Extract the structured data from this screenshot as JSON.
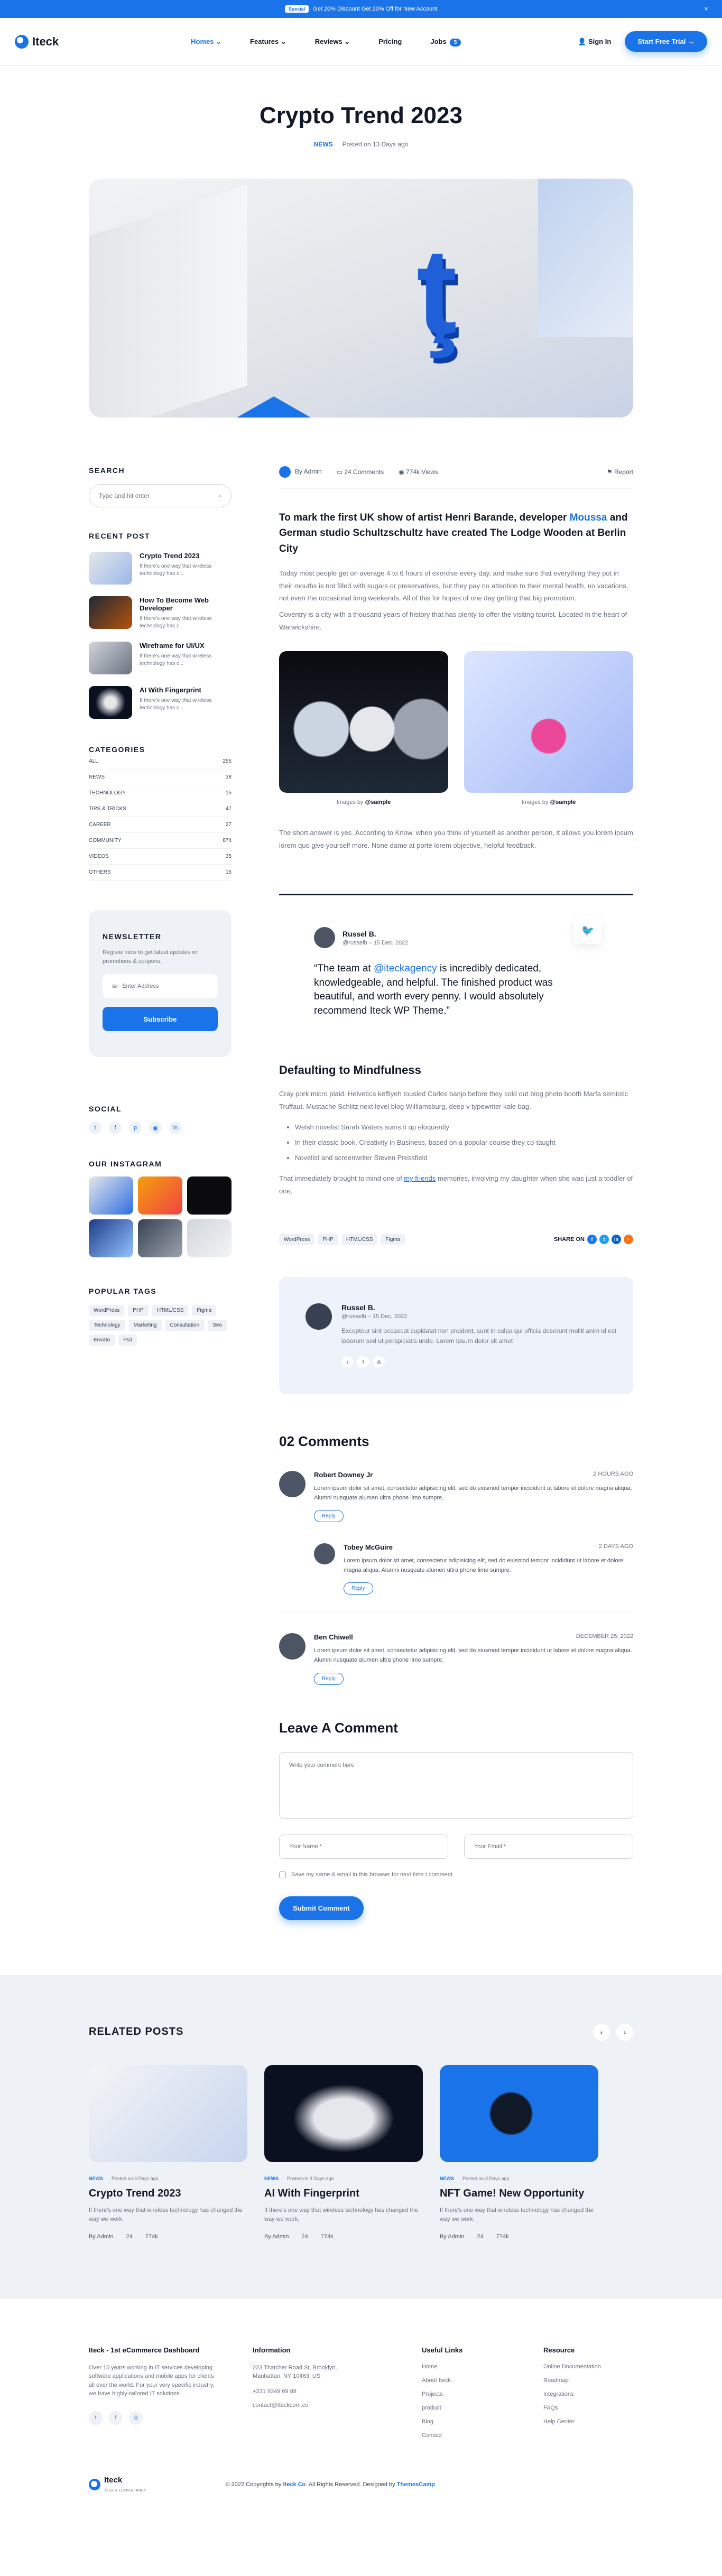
{
  "promo": {
    "pill": "Special",
    "text": "Get 20% Discount Get 20% Off for New Account",
    "close": "×"
  },
  "header": {
    "logo": "Iteck",
    "nav": [
      {
        "label": "Homes ⌄"
      },
      {
        "label": "Features ⌄"
      },
      {
        "label": "Reviews ⌄"
      },
      {
        "label": "Pricing"
      },
      {
        "label": "Jobs"
      }
    ],
    "jobs_badge": "5",
    "sign_in": "Sign In",
    "cta": "Start Free Trial →"
  },
  "post": {
    "title": "Crypto Trend 2023",
    "category": "NEWS",
    "posted": "Posted on 13 Days ago",
    "by": "By Admin",
    "comments": "24 Comments",
    "views": "774k Views",
    "report": "Report",
    "lead_a": "To mark the first UK show of artist Henri Barande, developer ",
    "lead_hl": "Moussa",
    "lead_b": " and German studio Schultzschultz have created The Lodge Wooden at Berlin City",
    "p1": "Today most people get on average 4 to 6 hours of exercise every day, and make sure that everything they put in their mouths is not filled with sugars or preservatives, but they pay no attention to their mental health, no vacations, not even the occasional long weekends. All of this for hopes of one day getting that big promotion.",
    "p2": "Coventry is a city with a thousand years of history that has plenty to offer the visiting tourist. Located in the heart of Warwickshire.",
    "cap_pre": "Images by ",
    "cap1": "@sample",
    "cap2": "@sample",
    "p3": "The short answer is yes. According to Know, when you think of yourself as another person, it allows you lorem ipsum lorem quo give yourself more. None dame at porte lorem objective, helpful feedback.",
    "quote_name": "Russel B.",
    "quote_sub": "@russelb – 15 Dec, 2022",
    "quote_a": "“The team at ",
    "quote_hl": "@iteckagency",
    "quote_b": " is incredibly dedicated, knowledgeable, and helpful. The finished product was beautiful, and worth every penny. I would absolutely recommend Iteck WP Theme.”",
    "h2": "Defaulting to Mindfulness",
    "p4": "Cray pork micro plaid. Helvetica keffiyeh tousled Carles banjo before they sold out blog photo booth Marfa semiotic Truffaut. Mustache Schlitz next level blog Williamsburg, deep v typewriter kale bag.",
    "bullets": [
      "Welsh novelist Sarah Waters sums it up eloquently",
      "In their classic book, Creativity in Business, based on a popular course they co-taught",
      "Novelist and screenwriter Steven Pressfield"
    ],
    "p5a": "That immediately brought to mind one of ",
    "p5link": "my friends",
    "p5b": " memories, involving my daughter when she was just a toddler of one.",
    "tags": [
      "WordPress",
      "PHP",
      "HTML/CSS",
      "Figma"
    ],
    "share": "SHARE ON",
    "author_name": "Russel B.",
    "author_sub": "@russelb – 15 Dec, 2022",
    "author_text": "Excepteur sint occaecat cupidatat non proident, sunt in culpa qui officia deserunt mollit anim id est laborum sed ut perspiciatis unde. Lorem ipsum dolor sit amet"
  },
  "comments": {
    "heading": "02 Comments",
    "items": [
      {
        "name": "Robert Downey Jr",
        "time": "2 HOURS AGO",
        "text": "Lorem ipsum dolor sit amet, consectetur adipisicing elit, sed do eiusmod tempor incididunt ut labore et dolore magna aliqua. Alumni nusquate alumen ultra phone limo sumpre.",
        "reply": "Reply"
      },
      {
        "name": "Tobey McGuire",
        "time": "2 DAYS AGO",
        "text": "Lorem ipsum dolor sit amet, consectetur adipisicing elit, sed do eiusmod tempor incididunt ut labore et dolore magna aliqua. Alumni nusquate alumen ultra phone limo sumpre.",
        "reply": "Reply"
      },
      {
        "name": "Ben Chiwell",
        "time": "DECEMBER 25, 2022",
        "text": "Lorem ipsum dolor sit amet, consectetur adipisicing elit, sed do eiusmod tempor incididunt ut labore et dolore magna aliqua. Alumni nusquate alumen ultra phone limo sumpre.",
        "reply": "Reply"
      }
    ]
  },
  "form": {
    "heading": "Leave A Comment",
    "comment_ph": "Write your comment here",
    "name_ph": "Your Name *",
    "email_ph": "Your Email *",
    "save": "Save my name & email in this browser for next time I comment",
    "submit": "Submit Comment"
  },
  "sidebar": {
    "search_title": "SEARCH",
    "search_ph": "Type and hit enter",
    "recent_title": "RECENT POST",
    "recent": [
      {
        "title": "Crypto Trend 2023",
        "desc": "If there's one way that wireless technology has c..."
      },
      {
        "title": "How To Become Web Developer",
        "desc": "If there's one way that wireless technology has c..."
      },
      {
        "title": "Wireframe for UI/UX",
        "desc": "If there's one way that wireless technology has c..."
      },
      {
        "title": "AI With Fingerprint",
        "desc": "If there's one way that wireless technology has c..."
      }
    ],
    "cat_title": "CATEGORIES",
    "cats": [
      {
        "name": "ALL",
        "count": "255"
      },
      {
        "name": "NEWS",
        "count": "38"
      },
      {
        "name": "TECHNOLOGY",
        "count": "15"
      },
      {
        "name": "TIPS & TRICKS",
        "count": "47"
      },
      {
        "name": "CAREER",
        "count": "27"
      },
      {
        "name": "COMMUNITY",
        "count": "874"
      },
      {
        "name": "VIDEOS",
        "count": "35"
      },
      {
        "name": "OTHERS",
        "count": "15"
      }
    ],
    "nl_title": "NEWSLETTER",
    "nl_text": "Register now to get latest updates on promotions & coupons.",
    "nl_ph": "Enter Address",
    "nl_btn": "Subscribe",
    "social_title": "SOCIAL",
    "insta_title": "OUR INSTAGRAM",
    "tags_title": "POPULAR TAGS",
    "tags": [
      "WordPress",
      "PHP",
      "HTML/CSS",
      "Figma",
      "Technology",
      "Marketing",
      "Consultation",
      "Seo",
      "Envato",
      "Psd"
    ]
  },
  "related": {
    "heading": "RELATED POSTS",
    "cards": [
      {
        "cat": "NEWS",
        "posted": "Posted on 3 Days ago",
        "title": "Crypto Trend 2023",
        "desc": "If there's one way that wireless technology has changed the way we work.",
        "by": "By Admin",
        "c": "24",
        "v": "774k"
      },
      {
        "cat": "NEWS",
        "posted": "Posted on 3 Days ago",
        "title": "AI With Fingerprint",
        "desc": "If there's one way that wireless technology has changed the way we work.",
        "by": "By Admin",
        "c": "24",
        "v": "774k"
      },
      {
        "cat": "NEWS",
        "posted": "Posted on 3 Days ago",
        "title": "NFT Game! New Opportunity",
        "desc": "If there's one way that wireless technology has changed the way we work.",
        "by": "By Admin",
        "c": "24",
        "v": "774k"
      }
    ]
  },
  "footer": {
    "c1_title": "Iteck - 1st eCommerce Dashboard",
    "c1_text": "Over 15 years working in IT services developing software applications and mobile apps for clients all over the world. For your very specific industry, we have highly-tailored IT solutions.",
    "c2_title": "Information",
    "c2_lines": [
      "223 Thatcher Road St, Brooklyn, Manhattan, NY 10463, US",
      "+231 9349 69 88",
      "contact@Iteckcom.co"
    ],
    "c3_title": "Useful Links",
    "c3_links": [
      "Home",
      "About Iteck",
      "Projects",
      "product",
      "Blog",
      "Contact"
    ],
    "c4_title": "Resource",
    "c4_links": [
      "Online Documentation",
      "Roadmap",
      "Integrations",
      "FAQs",
      "Help Center"
    ],
    "copy_a": "© 2022 Copyrights by ",
    "copy_b": "Iteck Co",
    "copy_c": ". All Rights Reserved. Designed by ",
    "copy_d": "ThemesCamp",
    "logo": "Iteck",
    "logo_sub": "TECH & CONSULTANCY"
  }
}
